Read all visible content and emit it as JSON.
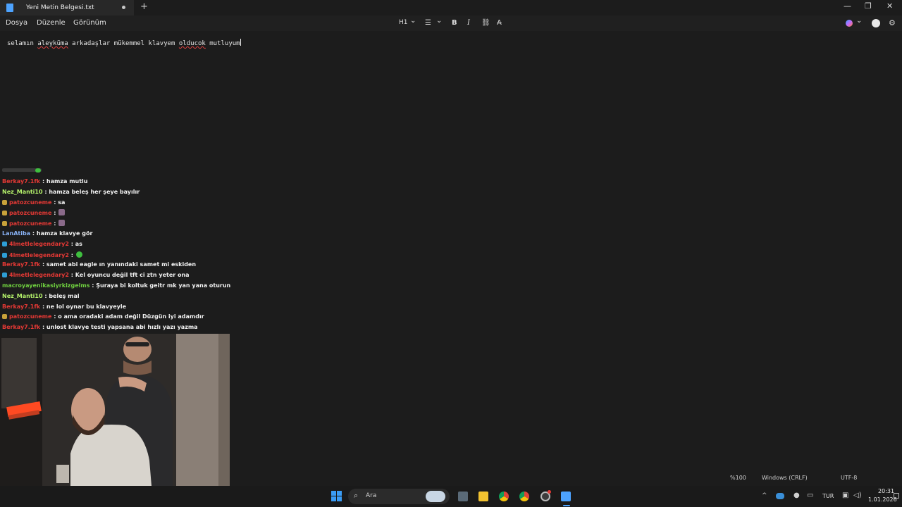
{
  "window": {
    "tab_title": "Yeni Metin Belgesi.txt",
    "new_tab": "+",
    "minimize": "—",
    "maximize": "❐",
    "close": "✕"
  },
  "menu": {
    "file": "Dosya",
    "edit": "Düzenle",
    "view": "Görünüm"
  },
  "toolbar": {
    "heading": "H1",
    "heading_chevron": "⌄",
    "list": "☰",
    "list_chevron": "⌄",
    "bold": "B",
    "italic": "I",
    "link": "⛓",
    "clear_format": "A̶",
    "copilot_chevron": "⌄"
  },
  "document": {
    "words": [
      "selamın",
      "aleyküma",
      "arkadaşlar",
      "mükemmel",
      "klavyem",
      "olducok",
      "mutluyum"
    ]
  },
  "chat": {
    "messages": [
      {
        "user": "Berkay7.1fk",
        "text": ": hamza mutlu",
        "color": "#e53935",
        "badge": ""
      },
      {
        "user": "Nez_Manti10",
        "text": ": hamza beleş her şeye bayılır",
        "color": "#b5f26b",
        "badge": ""
      },
      {
        "user": "patozcuneme",
        "text": ": sa",
        "color": "#e53935",
        "badge": "#c8a23a"
      },
      {
        "user": "patozcuneme",
        "text": ":",
        "color": "#e53935",
        "badge": "#c8a23a"
      },
      {
        "user": "patozcuneme",
        "text": ":",
        "color": "#e53935",
        "badge": "#c8a23a"
      },
      {
        "user": "LanAtiba",
        "text": ": hamza klavye gör",
        "color": "#8ab4f8",
        "badge": ""
      },
      {
        "user": "4lmetlelegendary2",
        "text": ": as",
        "color": "#e53935",
        "badge": "#2e9fd6"
      },
      {
        "user": "4lmetlelegendary2",
        "text": ":",
        "color": "#e53935",
        "badge": "#2e9fd6"
      },
      {
        "user": "Berkay7.1fk",
        "text": ": samet abi eagle ın yanındaki samet mi eskiden",
        "color": "#e53935",
        "badge": ""
      },
      {
        "user": "4lmetlelegendary2",
        "text": ": Kel oyuncu değil tft ci ztn yeter ona",
        "color": "#e53935",
        "badge": "#2e9fd6"
      },
      {
        "user": "macroyayenikasiyrkizgelms",
        "text": ": Şuraya bi koltuk geitr mk yan yana oturun",
        "color": "#6fcf3f",
        "badge": ""
      },
      {
        "user": "Nez_Manti10",
        "text": ": beleş mal",
        "color": "#b5f26b",
        "badge": ""
      },
      {
        "user": "Berkay7.1fk",
        "text": ": ne lol oynar bu klavyeyle",
        "color": "#e53935",
        "badge": ""
      },
      {
        "user": "patozcuneme",
        "text": ": o ama oradaki adam değil Düzgün iyi adamdır",
        "color": "#e53935",
        "badge": "#c8a23a"
      },
      {
        "user": "Berkay7.1fk",
        "text": ": unlost klavye testi yapsana abi hızlı yazı yazma",
        "color": "#e53935",
        "badge": ""
      }
    ]
  },
  "statusbar": {
    "zoom": "%100",
    "line_ending": "Windows (CRLF)",
    "encoding": "UTF-8"
  },
  "taskbar": {
    "search_placeholder": "Ara",
    "lang": "TUR",
    "time": "20:31",
    "date": "1.01.2026"
  }
}
